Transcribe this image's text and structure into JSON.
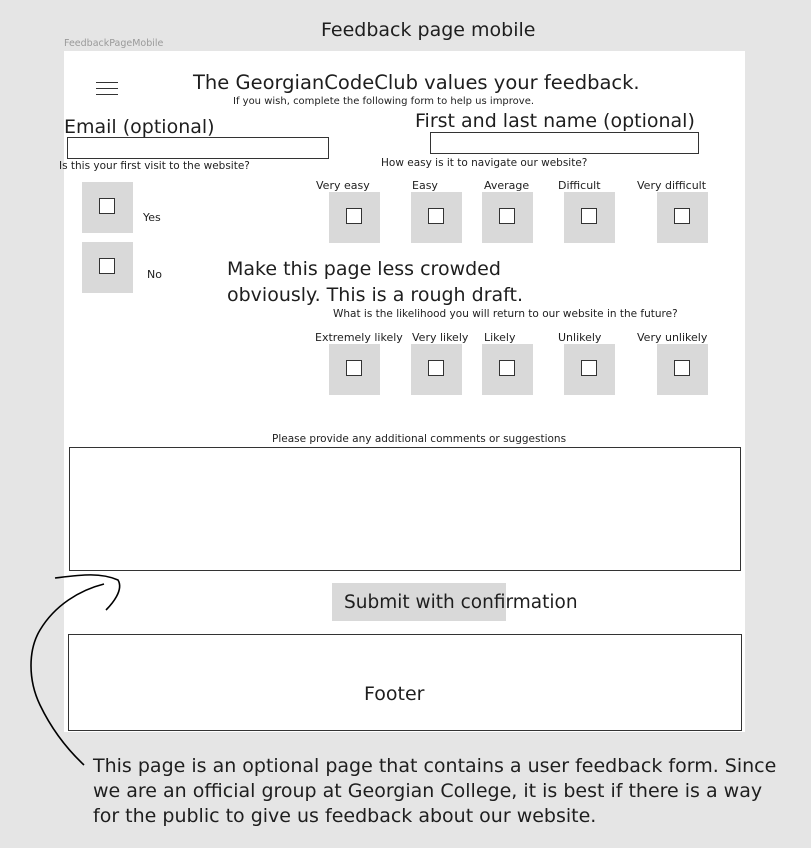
{
  "canvas": {
    "title": "Feedback page mobile",
    "frame_label": "FeedbackPageMobile"
  },
  "page": {
    "menu_icon": "hamburger-menu-icon",
    "heading": "The GeorgianCodeClub values your feedback.",
    "subheading": "If you wish, complete the following form to help us improve.",
    "email_label": "Email (optional)",
    "name_label": "First and last name (optional)",
    "first_visit_question": "Is this your first visit to the website?",
    "first_visit_options": [
      "Yes",
      "No"
    ],
    "navigation_question": "How easy is it to navigate our website?",
    "navigation_options": [
      "Very easy",
      "Easy",
      "Average",
      "Difficult",
      "Very difficult"
    ],
    "design_note": "Make this page less crowded obviously. This is a rough draft.",
    "return_question": "What is the likelihood you will return to our website in the future?",
    "return_options": [
      "Extremely likely",
      "Very likely",
      "Likely",
      "Unlikely",
      "Very unlikely"
    ],
    "comments_label": "Please provide any additional comments or suggestions",
    "submit_label": "Submit with confirmation",
    "footer_label": "Footer"
  },
  "annotation": "This page is an optional page that contains a user feedback form. Since we are an official group at Georgian College, it is best if there is a way for the public to give us feedback about our website."
}
